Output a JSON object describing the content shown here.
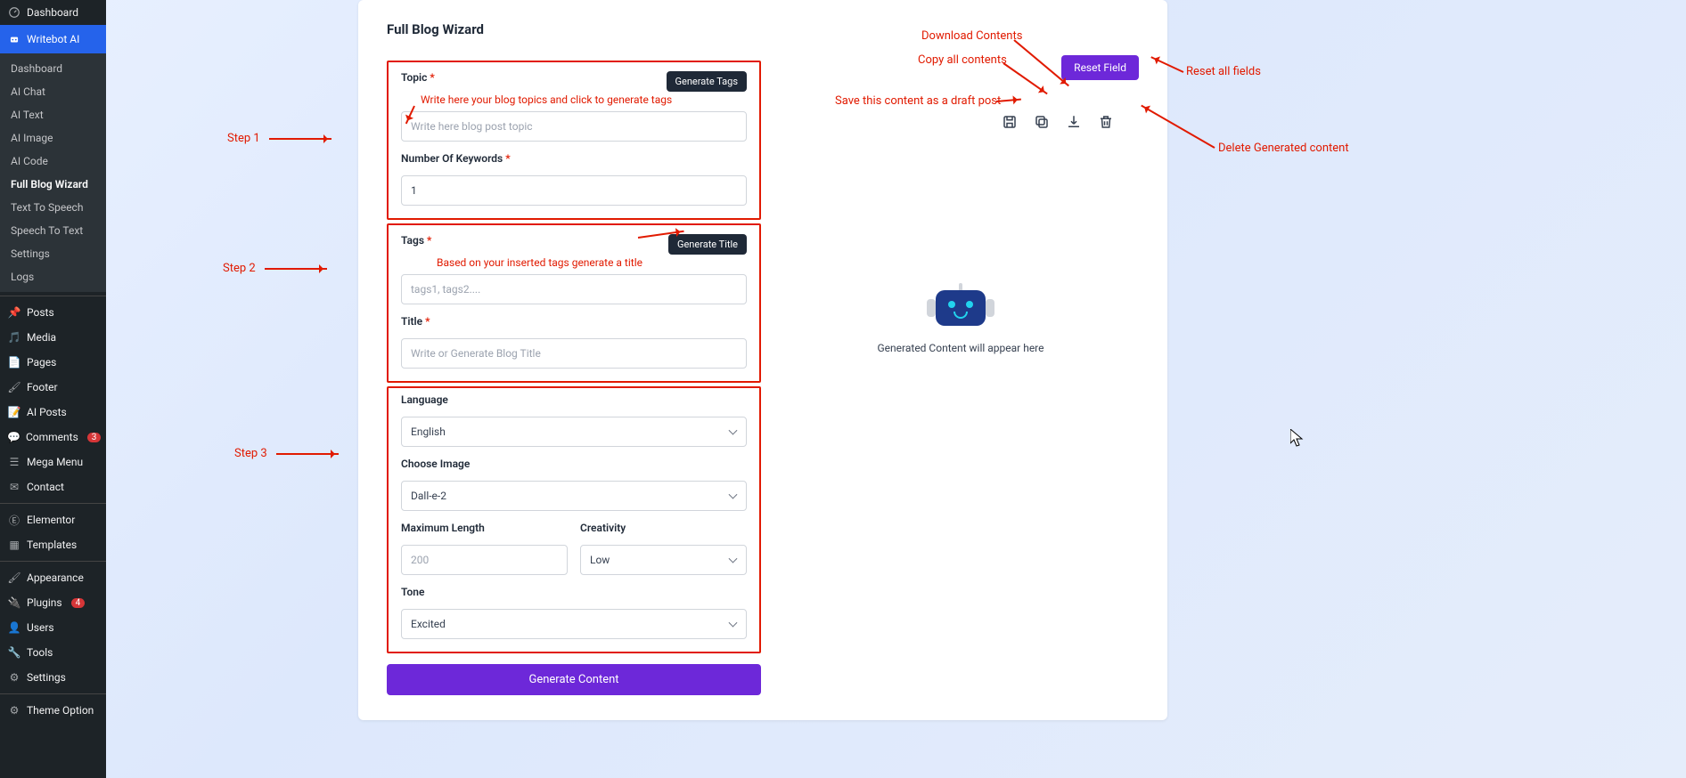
{
  "sidebar": {
    "top": [
      {
        "label": "Dashboard",
        "icon": "speedometer"
      },
      {
        "label": "Writebot AI",
        "icon": "robot",
        "active": true
      }
    ],
    "sub": [
      "Dashboard",
      "AI Chat",
      "AI Text",
      "AI Image",
      "AI Code",
      "Full Blog Wizard",
      "Text To Speech",
      "Speech To Text",
      "Settings",
      "Logs"
    ],
    "sub_active": "Full Blog Wizard",
    "groups": [
      {
        "label": "Posts",
        "icon": "pin"
      },
      {
        "label": "Media",
        "icon": "media"
      },
      {
        "label": "Pages",
        "icon": "page"
      },
      {
        "label": "Footer",
        "icon": "brush"
      },
      {
        "label": "AI Posts",
        "icon": "ai-post"
      },
      {
        "label": "Comments",
        "icon": "comment",
        "badge": "3"
      },
      {
        "label": "Mega Menu",
        "icon": "menu"
      },
      {
        "label": "Contact",
        "icon": "mail"
      }
    ],
    "groups2": [
      {
        "label": "Elementor",
        "icon": "elementor"
      },
      {
        "label": "Templates",
        "icon": "templates"
      }
    ],
    "groups3": [
      {
        "label": "Appearance",
        "icon": "brush2"
      },
      {
        "label": "Plugins",
        "icon": "plug",
        "badge": "4"
      },
      {
        "label": "Users",
        "icon": "user"
      },
      {
        "label": "Tools",
        "icon": "wrench"
      },
      {
        "label": "Settings",
        "icon": "gear"
      }
    ],
    "groups4": [
      {
        "label": "Theme Option",
        "icon": "sliders"
      }
    ]
  },
  "page": {
    "title": "Full Blog Wizard",
    "reset_btn": "Reset Field",
    "generate_btn": "Generate Content",
    "placeholder_text": "Generated Content will appear here"
  },
  "form": {
    "topic_label": "Topic",
    "topic_help": "Write here your blog topics and click to generate tags",
    "topic_placeholder": "Write here blog post topic",
    "gen_tags_btn": "Generate Tags",
    "num_keywords_label": "Number Of Keywords",
    "num_keywords_value": "1",
    "tags_label": "Tags",
    "tags_help": "Based on your inserted tags generate a title",
    "tags_placeholder": "tags1, tags2....",
    "gen_title_btn": "Generate Title",
    "title_label": "Title",
    "title_placeholder": "Write or Generate Blog Title",
    "language_label": "Language",
    "language_value": "English",
    "choose_image_label": "Choose Image",
    "choose_image_value": "Dall-e-2",
    "max_length_label": "Maximum Length",
    "max_length_value": "200",
    "creativity_label": "Creativity",
    "creativity_value": "Low",
    "tone_label": "Tone",
    "tone_value": "Excited"
  },
  "annotations": {
    "step1": "Step 1",
    "step2": "Step 2",
    "step3": "Step 3",
    "download": "Download Contents",
    "copy": "Copy all contents",
    "save": "Save this content as a draft post",
    "reset": "Reset all fields",
    "delete": "Delete Generated content"
  }
}
